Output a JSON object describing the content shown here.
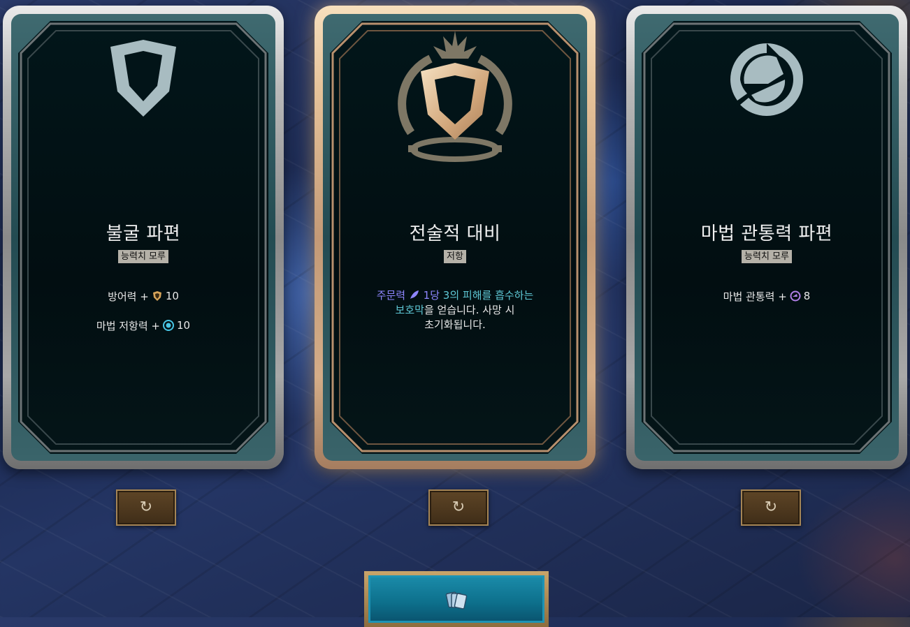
{
  "cards": [
    {
      "icon": "shield-icon",
      "title": "불굴 파편",
      "tag": "능력치 모루",
      "stats": [
        {
          "label": "방어력 +",
          "icon": "armor-icon",
          "value": "10"
        },
        {
          "label": "마법 저항력 +",
          "icon": "magic-resist-icon",
          "value": "10"
        }
      ],
      "reroll_icon": "refresh-icon"
    },
    {
      "icon": "radiant-shield-icon",
      "title": "전술적 대비",
      "tag": "저항",
      "description": {
        "part1": "주문력",
        "part2": "1당",
        "part3": "3의 피해를 흡수하는",
        "part4": "보호막",
        "part5": "을 얻습니다. 사망 시",
        "part6": "초기화됩니다."
      },
      "reroll_icon": "refresh-icon"
    },
    {
      "icon": "magic-penetration-icon",
      "title": "마법 관통력 파편",
      "tag": "능력치 모루",
      "stats": [
        {
          "label": "마법 관통력 +",
          "icon": "magic-pen-icon",
          "value": "8"
        }
      ],
      "reroll_icon": "refresh-icon"
    }
  ],
  "deck_button": {
    "icon": "cards-icon"
  },
  "colors": {
    "silver_frame": "#b9b9b9",
    "gold_frame": "#e6c39a",
    "tag_bg": "#b5b1a8",
    "purple_text": "#8e86ff",
    "teal_text": "#5fc8d6"
  }
}
